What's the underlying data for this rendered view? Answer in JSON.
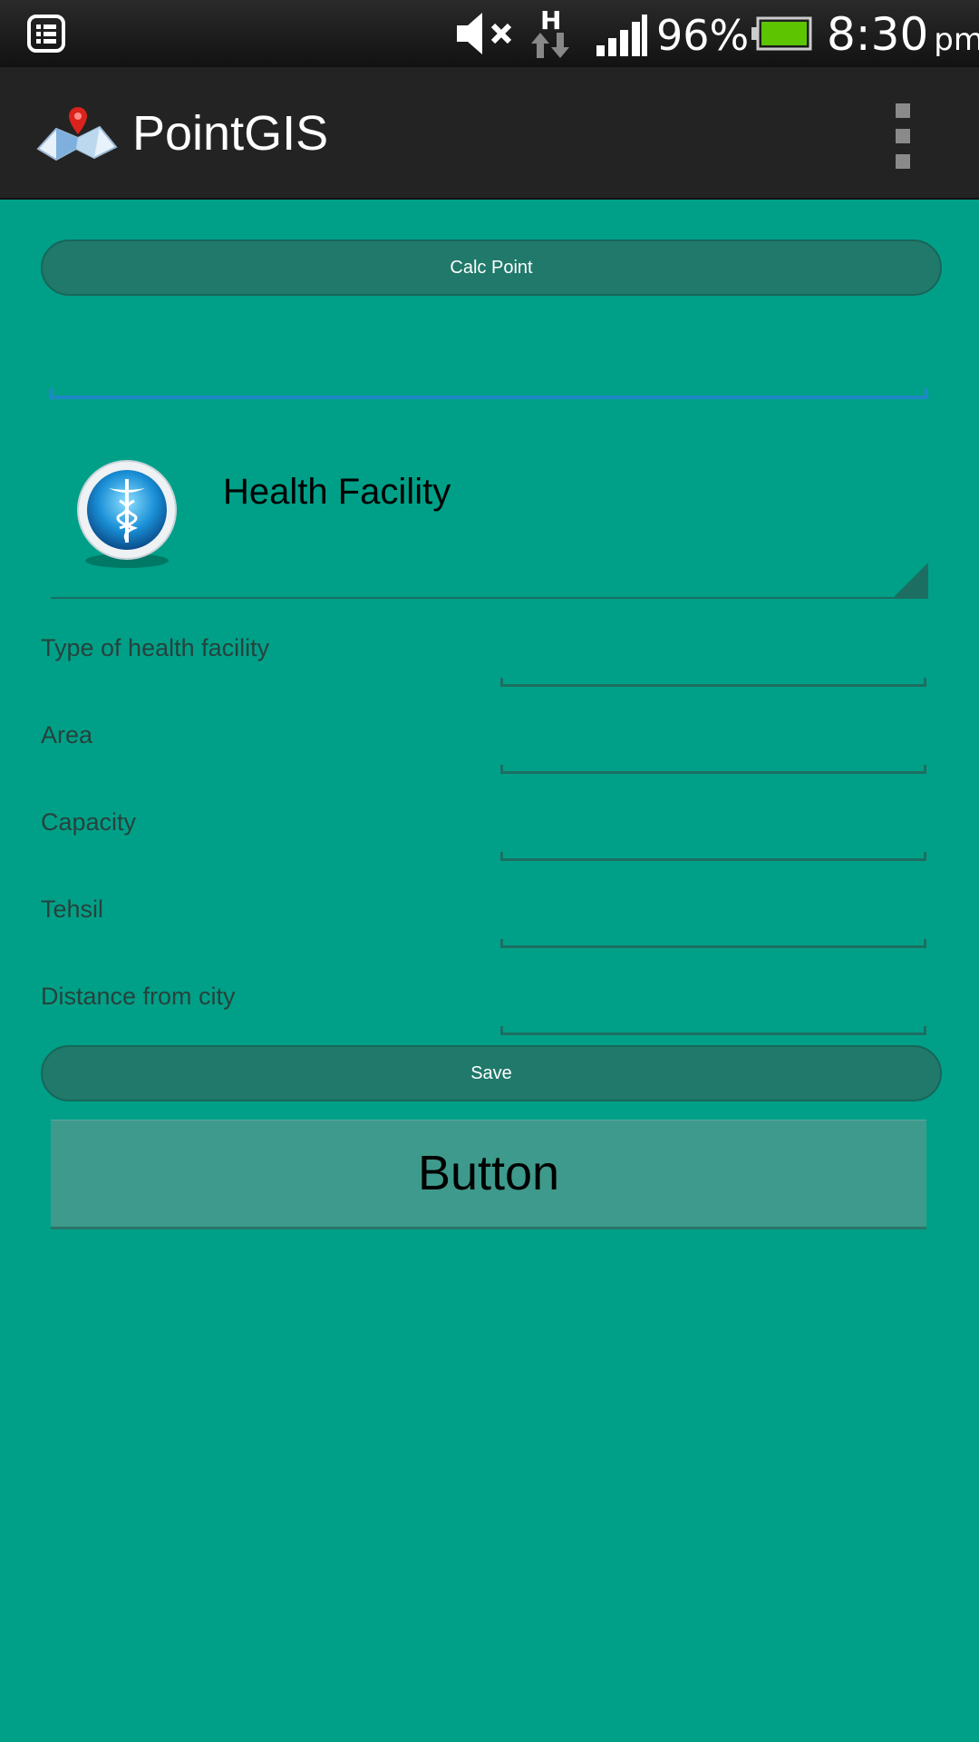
{
  "status_bar": {
    "battery_percent": "96%",
    "time": "8:30",
    "ampm": "pm",
    "network_type": "H",
    "icons": [
      "notification-list-icon",
      "mute-icon",
      "data-transfer-icon",
      "signal-icon",
      "battery-icon"
    ]
  },
  "action_bar": {
    "title": "PointGIS"
  },
  "calc_button": {
    "label": "Calc Point"
  },
  "top_input": {
    "value": ""
  },
  "spinner": {
    "selected": "Health Facility"
  },
  "form": {
    "fields": [
      {
        "label": "Type of health facility",
        "value": ""
      },
      {
        "label": "Area",
        "value": ""
      },
      {
        "label": "Capacity",
        "value": ""
      },
      {
        "label": "Tehsil",
        "value": ""
      },
      {
        "label": "Distance from city",
        "value": ""
      }
    ]
  },
  "save_button": {
    "label": "Save"
  },
  "generic_button": {
    "label": "Button"
  },
  "colors": {
    "background": "#00A088",
    "action_bar": "#232323",
    "pill_button": "#20796A",
    "focus_underline": "#1E88C7",
    "battery_green": "#5CC400"
  }
}
